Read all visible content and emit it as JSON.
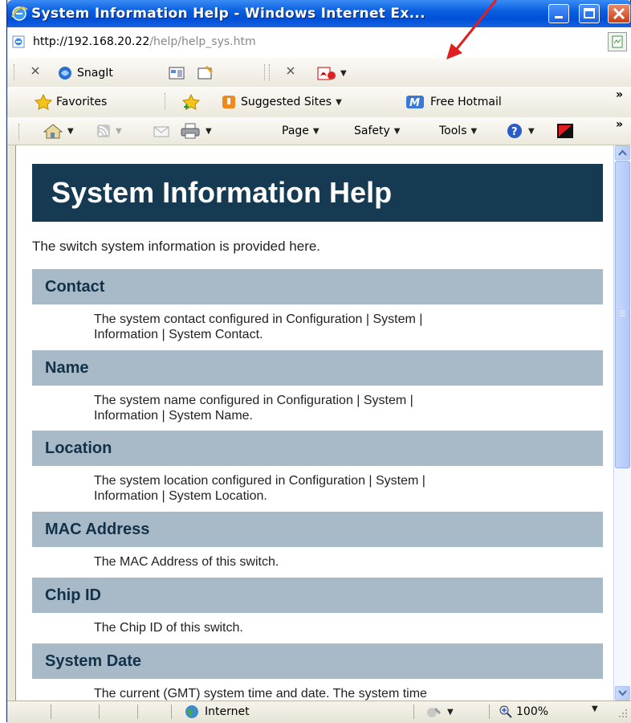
{
  "window": {
    "title": "System Information Help - Windows Internet Ex...",
    "url_host": "http://192.168.20.22",
    "url_path": "/help/help_sys.htm"
  },
  "toolbar1": {
    "snagit_label": "SnagIt"
  },
  "favorites_bar": {
    "favorites_label": "Favorites",
    "suggested_sites_label": "Suggested Sites",
    "free_hotmail_label": "Free Hotmail",
    "overflow_label": "»"
  },
  "command_bar": {
    "page_label": "Page",
    "safety_label": "Safety",
    "tools_label": "Tools",
    "overflow_label": "»"
  },
  "page": {
    "title": "System Information Help",
    "intro": "The switch system information is provided here.",
    "sections": [
      {
        "heading": "Contact",
        "line1": "The system contact configured in Configuration | System |",
        "line2": "Information | System Contact."
      },
      {
        "heading": "Name",
        "line1": "The system name configured in Configuration | System |",
        "line2": "Information | System Name."
      },
      {
        "heading": "Location",
        "line1": "The system location configured in Configuration | System |",
        "line2": "Information | System Location."
      },
      {
        "heading": "MAC Address",
        "line1": "The MAC Address of this switch.",
        "line2": ""
      },
      {
        "heading": "Chip ID",
        "line1": "The Chip ID of this switch.",
        "line2": ""
      },
      {
        "heading": "System Date",
        "line1": "The current (GMT) system time and date. The system time",
        "line2": ""
      }
    ]
  },
  "statusbar": {
    "zone_label": "Internet",
    "zoom_label": "100%"
  },
  "colors": {
    "banner": "#163a52",
    "section_header": "#a8b9c8",
    "annotation_arrow": "#e02020"
  }
}
